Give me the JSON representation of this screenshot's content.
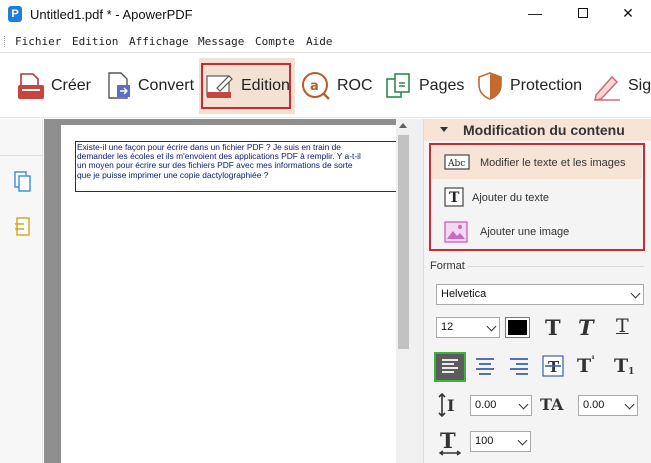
{
  "window": {
    "title": "Untitled1.pdf * - ApowerPDF",
    "app_icon_letter": "P",
    "minimize": "—",
    "close": "✕"
  },
  "menu": [
    "Fichier",
    "Edition",
    "Affichage",
    "Message",
    "Compte",
    "Aide"
  ],
  "toolbar": {
    "items": [
      {
        "label": "Créer",
        "icon": "create-icon"
      },
      {
        "label": "Convert",
        "icon": "convert-icon"
      },
      {
        "label": "Edition",
        "icon": "edit-icon"
      },
      {
        "label": "ROC",
        "icon": "ocr-icon"
      },
      {
        "label": "Pages",
        "icon": "pages-icon"
      },
      {
        "label": "Protection",
        "icon": "shield-icon"
      },
      {
        "label": "Sig",
        "icon": "signature-icon"
      }
    ],
    "active": "Edition"
  },
  "document": {
    "text_lines": [
      "Existe-il une façon pour écrire dans un fichier PDF ? Je suis en train de",
      "demander les écoles et ils m'envoient des applications PDF à remplir. Y a-t-il",
      "un moyen pour écrire sur des fichiers PDF avec mes informations de sorte",
      "que je puisse imprimer une copie dactylographiée ?"
    ]
  },
  "panel": {
    "header": "Modification du contenu",
    "actions": [
      {
        "label": "Modifier le texte et les images",
        "icon": "edit-text-image-icon",
        "selected": true
      },
      {
        "label": "Ajouter du texte",
        "icon": "add-text-icon",
        "selected": false
      },
      {
        "label": "Ajouter une image",
        "icon": "add-image-icon",
        "selected": false
      }
    ],
    "format_label": "Format",
    "font": "Helvetica",
    "font_size": "12",
    "text_color": "#000000",
    "line_spacing": "0.00",
    "char_spacing": "0.00",
    "horizontal_scale": "100",
    "alignment": "left"
  },
  "colors": {
    "accent_highlight": "#f7e4d6",
    "annotation_red": "#d0282c",
    "text_box_border": "#1c2a8c"
  }
}
